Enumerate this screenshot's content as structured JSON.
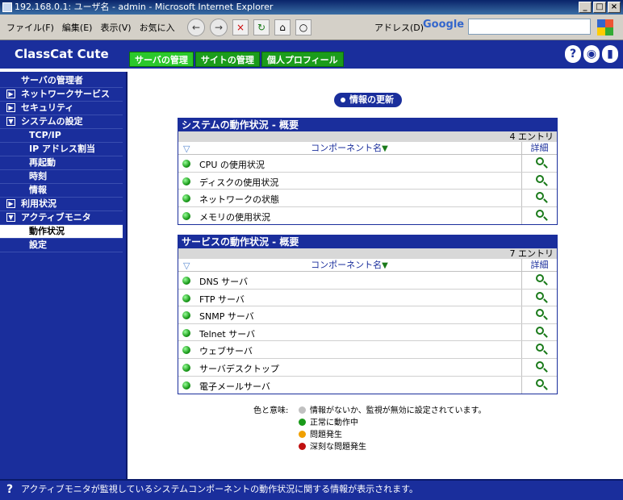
{
  "window": {
    "title": "192.168.0.1: ユーザ名 - admin - Microsoft Internet Explorer"
  },
  "browser": {
    "menu": [
      "ファイル(F)",
      "編集(E)",
      "表示(V)",
      "お気に入"
    ],
    "address_label": "アドレス(D)",
    "search_engine": "Google",
    "search_value": ""
  },
  "header": {
    "logo": "ClassCat Cute",
    "tabs": [
      "サーバの管理",
      "サイトの管理",
      "個人プロフィール"
    ]
  },
  "sidebar": {
    "items": [
      {
        "label": "サーバの管理者"
      },
      {
        "label": "ネットワークサービス"
      },
      {
        "label": "セキュリティ"
      },
      {
        "label": "システムの設定"
      },
      {
        "label": "TCP/IP"
      },
      {
        "label": "IP アドレス割当"
      },
      {
        "label": "再起動"
      },
      {
        "label": "時刻"
      },
      {
        "label": "情報"
      },
      {
        "label": "利用状況"
      },
      {
        "label": "アクティブモニタ"
      },
      {
        "label": "動作状況"
      },
      {
        "label": "設定"
      }
    ]
  },
  "main": {
    "refresh_label": "情報の更新",
    "system": {
      "title": "システムの動作状況 - 概要",
      "count": "4 エントリ",
      "col_component": "コンポーネント名",
      "col_detail": "詳細",
      "rows": [
        "CPU の使用状況",
        "ディスクの使用状況",
        "ネットワークの状態",
        "メモリの使用状況"
      ]
    },
    "service": {
      "title": "サービスの動作状況 - 概要",
      "count": "7 エントリ",
      "col_component": "コンポーネント名",
      "col_detail": "詳細",
      "rows": [
        "DNS サーバ",
        "FTP サーバ",
        "SNMP サーバ",
        "Telnet サーバ",
        "ウェブサーバ",
        "サーバデスクトップ",
        "電子メールサーバ"
      ]
    },
    "legend": {
      "label": "色と意味:",
      "items": [
        {
          "text": "情報がないか、監視が無効に設定されています。",
          "color": "#c0c0c0"
        },
        {
          "text": "正常に動作中",
          "color": "#1a9a1a"
        },
        {
          "text": "問題発生",
          "color": "#f0a000"
        },
        {
          "text": "深刻な問題発生",
          "color": "#c01010"
        }
      ]
    }
  },
  "status": {
    "text": "アクティブモニタが監視しているシステムコンポーネントの動作状況に関する情報が表示されます。"
  }
}
